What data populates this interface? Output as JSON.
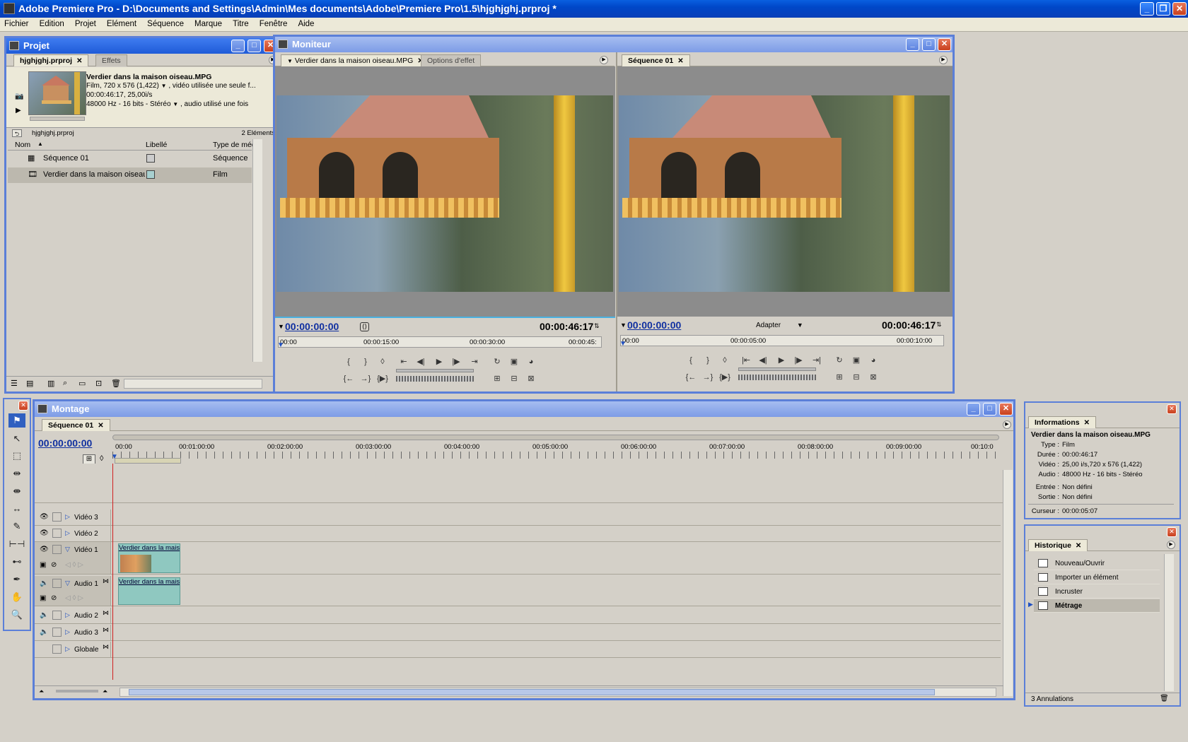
{
  "window": {
    "title": "Adobe Premiere Pro - D:\\Documents and Settings\\Admin\\Mes documents\\Adobe\\Premiere Pro\\1.5\\hjghjghj.prproj *",
    "min": "_",
    "max": "❐",
    "close": "✕"
  },
  "menu": [
    "Fichier",
    "Edition",
    "Projet",
    "Elément",
    "Séquence",
    "Marque",
    "Titre",
    "Fenêtre",
    "Aide"
  ],
  "projet": {
    "title": "Projet",
    "tabs": [
      "hjghjghj.prproj",
      "Effets"
    ],
    "clip_name": "Verdier dans la maison oiseau.MPG",
    "clip_line1": "Film, 720 x 576 (1,422)",
    "clip_line1b": ", vidéo utilisée une seule f...",
    "clip_line2": "00:00:46:17, 25,00i/s",
    "clip_line3": "48000 Hz - 16 bits - Stéréo",
    "clip_line3b": ", audio utilisé une fois",
    "bin_name": "hjghjghj.prproj",
    "count": "2 Eléments",
    "col_nom": "Nom",
    "col_libelle": "Libellé",
    "col_type": "Type de méd",
    "items": [
      {
        "name": "Séquence 01",
        "type": "Séquence"
      },
      {
        "name": "Verdier dans la maison oiseau.M",
        "type": "Film"
      }
    ]
  },
  "moniteur": {
    "title": "Moniteur",
    "source_tabs": [
      "Verdier dans la maison oiseau.MPG",
      "Options d'effet"
    ],
    "program_tab": "Séquence 01",
    "source_tc": "00:00:00:00",
    "source_dur": "00:00:46:17",
    "source_ruler": [
      "00:00",
      "00:00:15:00",
      "00:00:30:00",
      "00:00:45:"
    ],
    "program_tc": "00:00:00:00",
    "program_fit": "Adapter",
    "program_dur": "00:00:46:17",
    "program_ruler": [
      "00:00",
      "00:00:05:00",
      "00:00:10:00"
    ]
  },
  "montage": {
    "title": "Montage",
    "tab": "Séquence 01",
    "timecode": "00:00:00:00",
    "ruler": [
      "00:00",
      "00:01:00:00",
      "00:02:00:00",
      "00:03:00:00",
      "00:04:00:00",
      "00:05:00:00",
      "00:06:00:00",
      "00:07:00:00",
      "00:08:00:00",
      "00:09:00:00",
      "00:10:0"
    ],
    "tracks": [
      "Vidéo 3",
      "Vidéo 2",
      "Vidéo 1",
      "Audio 1",
      "Audio 2",
      "Audio 3",
      "Globale"
    ],
    "clip_label": "Verdier dans la maiso"
  },
  "informations": {
    "title": "Informations",
    "clip_name": "Verdier dans la maison oiseau.MPG",
    "rows": [
      {
        "k": "Type :",
        "v": "Film"
      },
      {
        "k": "Durée :",
        "v": "00:00:46:17"
      },
      {
        "k": "Vidéo :",
        "v": "25,00 i/s,720 x 576 (1,422)"
      },
      {
        "k": "Audio :",
        "v": "48000 Hz - 16 bits - Stéréo"
      }
    ],
    "entree_k": "Entrée :",
    "entree_v": "Non défini",
    "sortie_k": "Sortie :",
    "sortie_v": "Non défini",
    "curseur_k": "Curseur :",
    "curseur_v": "00:00:05:07"
  },
  "historique": {
    "title": "Historique",
    "items": [
      "Nouveau/Ouvrir",
      "Importer un élément",
      "Incruster",
      "Métrage"
    ],
    "footer": "3 Annulations"
  }
}
